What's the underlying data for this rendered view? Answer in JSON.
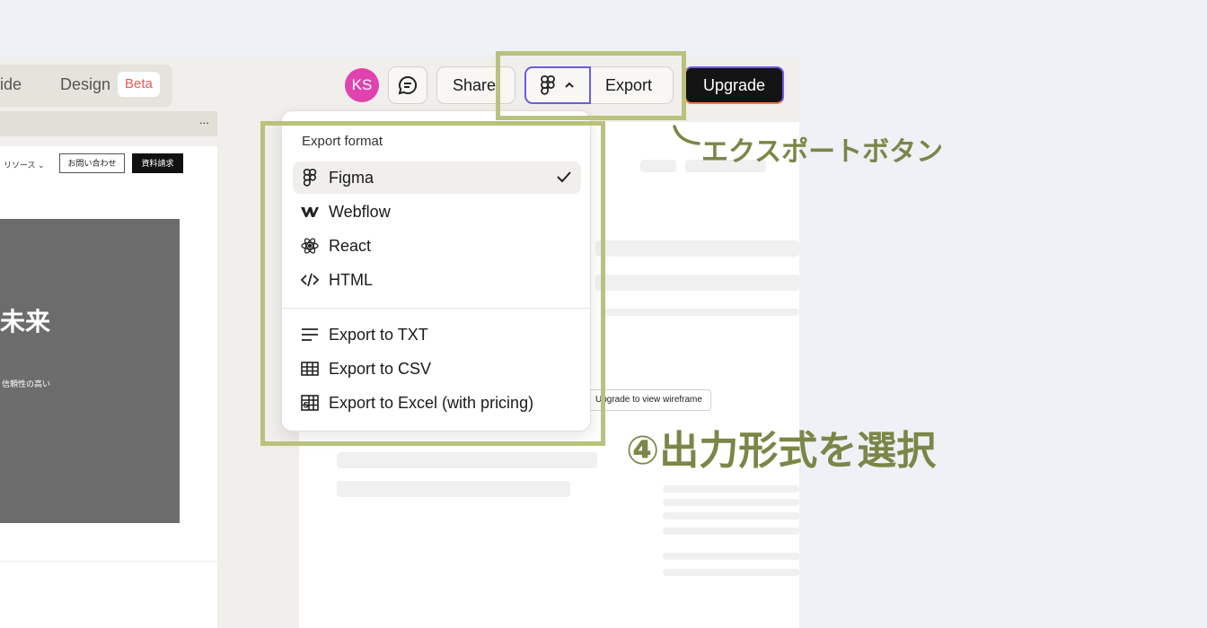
{
  "modes": {
    "guide": "ide",
    "design": "Design",
    "beta_badge": "Beta"
  },
  "header": {
    "avatar_initials": "KS",
    "share_label": "Share",
    "export_label": "Export",
    "upgrade_label": "Upgrade"
  },
  "left_panel": {
    "topbar_dots": "..."
  },
  "preview": {
    "nav_resources": "リソース ⌄",
    "contact_label": "お問い合わせ",
    "request_label": "資料請求",
    "hero_title": "未来",
    "hero_sub": "信頼性の高い"
  },
  "doc": {
    "wireframe_label": "Upgrade to view wireframe"
  },
  "dropdown": {
    "title": "Export format",
    "formats": [
      {
        "label": "Figma",
        "icon": "figma-icon",
        "selected": true
      },
      {
        "label": "Webflow",
        "icon": "webflow-icon",
        "selected": false
      },
      {
        "label": "React",
        "icon": "react-icon",
        "selected": false
      },
      {
        "label": "HTML",
        "icon": "code-icon",
        "selected": false
      }
    ],
    "exports": [
      {
        "label": "Export to TXT",
        "icon": "text-lines-icon"
      },
      {
        "label": "Export to CSV",
        "icon": "table-icon"
      },
      {
        "label": "Export to Excel (with pricing)",
        "icon": "spreadsheet-icon"
      }
    ]
  },
  "annotations": {
    "export_button": "エクスポートボタン",
    "select_format": "④出力形式を選択"
  },
  "colors": {
    "highlight": "#b9c27c",
    "annotation_text": "#7b8647",
    "accent": "#6c5ce7",
    "avatar": "#e043b0"
  }
}
